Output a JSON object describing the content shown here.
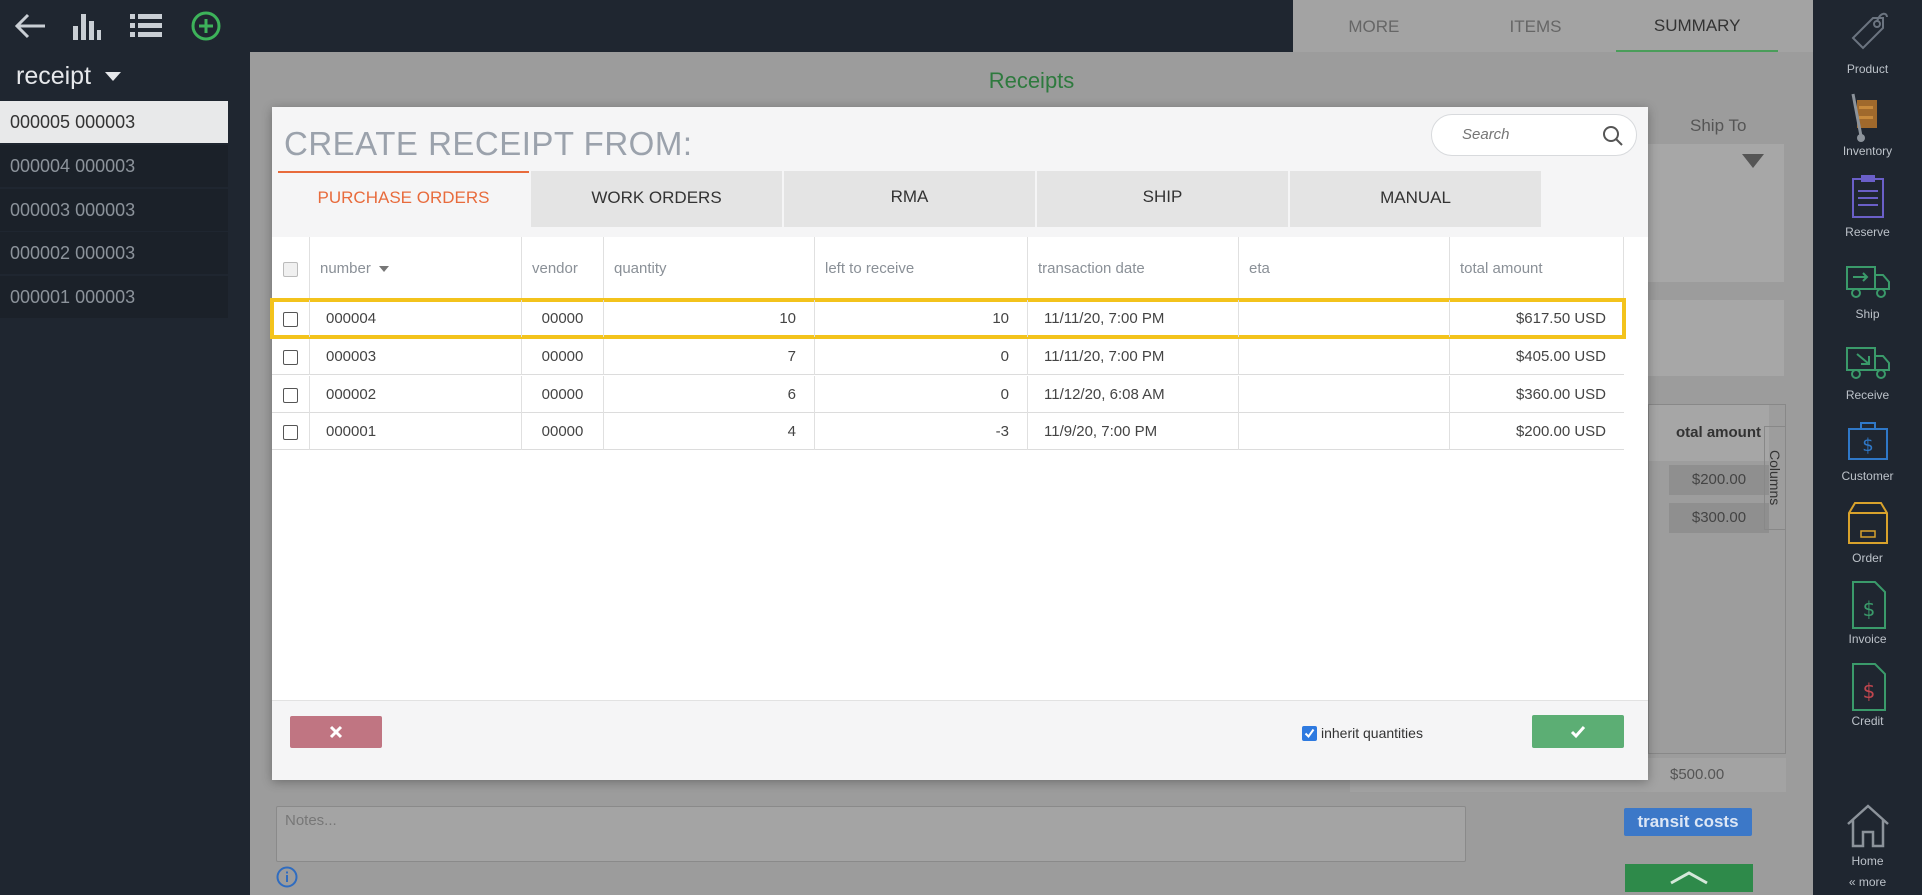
{
  "left": {
    "record_type": "receipt",
    "records": [
      "000005 000003",
      "000004 000003",
      "000003 000003",
      "000002 000003",
      "000001 000003"
    ]
  },
  "main": {
    "tabs": [
      "MORE",
      "ITEMS",
      "SUMMARY"
    ],
    "title": "Receipts",
    "ship_to_label": "Ship To",
    "grid_header": "otal amount",
    "grid_values": [
      "$200.00",
      "$300.00"
    ],
    "columns_label": "Columns",
    "subtotal_value": "$500.00",
    "notes_placeholder": "Notes...",
    "transit_costs_label": "transit costs"
  },
  "right_sidebar": {
    "items": [
      "Product",
      "Inventory",
      "Reserve",
      "Ship",
      "Receive",
      "Customer",
      "Order",
      "Invoice",
      "Credit",
      "Home"
    ],
    "more_label": "« more"
  },
  "modal": {
    "title": "CREATE RECEIPT FROM:",
    "search_placeholder": "Search",
    "tabs": [
      "PURCHASE ORDERS",
      "WORK ORDERS",
      "RMA",
      "SHIP",
      "MANUAL"
    ],
    "columns": [
      "number",
      "vendor",
      "quantity",
      "left to receive",
      "transaction date",
      "eta",
      "total amount"
    ],
    "rows": [
      {
        "number": "000004",
        "vendor": "00000",
        "quantity": "10",
        "left": "10",
        "date": "11/11/20, 7:00 PM",
        "eta": "",
        "total": "$617.50 USD"
      },
      {
        "number": "000003",
        "vendor": "00000",
        "quantity": "7",
        "left": "0",
        "date": "11/11/20, 7:00 PM",
        "eta": "",
        "total": "$405.00 USD"
      },
      {
        "number": "000002",
        "vendor": "00000",
        "quantity": "6",
        "left": "0",
        "date": "11/12/20, 6:08 AM",
        "eta": "",
        "total": "$360.00 USD"
      },
      {
        "number": "000001",
        "vendor": "00000",
        "quantity": "4",
        "left": "-3",
        "date": "11/9/20, 7:00 PM",
        "eta": "",
        "total": "$200.00 USD"
      }
    ],
    "inherit_label": "inherit quantities",
    "inherit_checked": true
  },
  "colors": {
    "accent_orange": "#e86b3c",
    "highlight": "#f3c31c",
    "confirm_green": "#5cae74",
    "cancel_red": "#c07582"
  }
}
